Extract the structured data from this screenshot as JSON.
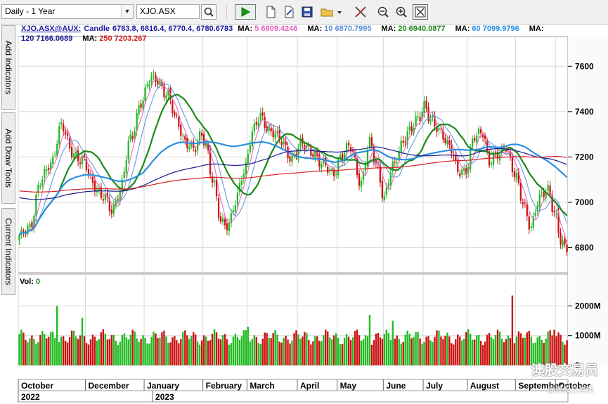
{
  "toolbar": {
    "period_value": "Daily - 1 Year",
    "symbol_value": "XJO.ASX"
  },
  "side_tabs": [
    "Add Indicators",
    "Add Draw Tools",
    "Current Indicators"
  ],
  "legend": {
    "symbol": "XJO.ASX@AUX:",
    "candle_label": "Candle",
    "ohlc": "6783.8, 6816.4, 6770.4, 6780.6783",
    "ma_prefix": "MA:",
    "ma": [
      {
        "period": "5",
        "value": "6809.4246",
        "color": "#e85ec0"
      },
      {
        "period": "10",
        "value": "6870.7995",
        "color": "#5b8fd6"
      },
      {
        "period": "20",
        "value": "6940.0877",
        "color": "#1a8a1a"
      },
      {
        "period": "60",
        "value": "7099.9796",
        "color": "#2a8fe0"
      },
      {
        "period": "120",
        "value": "7166.0689",
        "color": "#1a1a8a"
      },
      {
        "period": "250",
        "value": "7203.267",
        "color": "#d42020"
      }
    ]
  },
  "watermark": {
    "line1": "澳股交易员",
    "line2": "@澳股交易员"
  },
  "colors": {
    "up": "#22bb22",
    "down": "#cc1111",
    "grid": "#d8d8d8",
    "bg": "#ffffff"
  },
  "chart_data": {
    "type": "candlestick",
    "title": "XJO.ASX@AUX: Candle",
    "price_axis": {
      "ticks": [
        6800,
        7000,
        7200,
        7400,
        7600
      ],
      "labels": [
        "6800",
        "7000",
        "7200",
        "7400",
        "7600"
      ],
      "ylim": [
        6690,
        7700
      ]
    },
    "volume_axis": {
      "label": "Vol:",
      "value": "0",
      "ticks": [
        0,
        1000,
        2000
      ],
      "labels": [
        "0",
        "1000M",
        "2000M"
      ],
      "ylim": [
        0,
        2600
      ]
    },
    "x_months": [
      "October",
      "December",
      "January",
      "February",
      "March",
      "April",
      "May",
      "June",
      "July",
      "August",
      "September",
      "October"
    ],
    "x_years": [
      "2022",
      "2023"
    ],
    "price_anchors": [
      [
        0,
        6840
      ],
      [
        5,
        6900
      ],
      [
        10,
        7080
      ],
      [
        15,
        7180
      ],
      [
        20,
        7330
      ],
      [
        25,
        7230
      ],
      [
        30,
        7180
      ],
      [
        35,
        7090
      ],
      [
        40,
        7020
      ],
      [
        44,
        6960
      ],
      [
        48,
        7060
      ],
      [
        53,
        7270
      ],
      [
        58,
        7450
      ],
      [
        63,
        7540
      ],
      [
        66,
        7545
      ],
      [
        70,
        7480
      ],
      [
        75,
        7360
      ],
      [
        80,
        7260
      ],
      [
        83,
        7220
      ],
      [
        87,
        7310
      ],
      [
        89,
        7260
      ],
      [
        92,
        7090
      ],
      [
        96,
        6920
      ],
      [
        100,
        6910
      ],
      [
        103,
        6990
      ],
      [
        107,
        7140
      ],
      [
        111,
        7310
      ],
      [
        115,
        7370
      ],
      [
        120,
        7320
      ],
      [
        125,
        7260
      ],
      [
        130,
        7200
      ],
      [
        135,
        7250
      ],
      [
        140,
        7230
      ],
      [
        144,
        7160
      ],
      [
        150,
        7140
      ],
      [
        153,
        7190
      ],
      [
        158,
        7250
      ],
      [
        163,
        7080
      ],
      [
        167,
        7260
      ],
      [
        170,
        7190
      ],
      [
        174,
        7010
      ],
      [
        178,
        7160
      ],
      [
        182,
        7260
      ],
      [
        186,
        7300
      ],
      [
        190,
        7380
      ],
      [
        193,
        7430
      ],
      [
        196,
        7350
      ],
      [
        201,
        7320
      ],
      [
        205,
        7240
      ],
      [
        209,
        7140
      ],
      [
        213,
        7150
      ],
      [
        217,
        7280
      ],
      [
        221,
        7320
      ],
      [
        224,
        7180
      ],
      [
        228,
        7200
      ],
      [
        232,
        7260
      ],
      [
        236,
        7120
      ],
      [
        240,
        7000
      ],
      [
        244,
        6900
      ],
      [
        248,
        7010
      ],
      [
        252,
        7070
      ],
      [
        255,
        6960
      ],
      [
        258,
        6820
      ],
      [
        261,
        6781
      ]
    ],
    "ma_series": [
      {
        "name": "MA 5",
        "period": 5
      },
      {
        "name": "MA 10",
        "period": 10
      },
      {
        "name": "MA 20",
        "period": 20
      },
      {
        "name": "MA 60",
        "period": 60
      },
      {
        "name": "MA 120",
        "period": 120
      },
      {
        "name": "MA 250",
        "period": 250
      }
    ],
    "volume_typical_M": 950,
    "volume_spikes_M": [
      {
        "index": 18,
        "value": 2000
      },
      {
        "index": 30,
        "value": 1600
      },
      {
        "index": 109,
        "value": 1300
      },
      {
        "index": 167,
        "value": 1700
      },
      {
        "index": 178,
        "value": 1500
      },
      {
        "index": 235,
        "value": 2350
      },
      {
        "index": 255,
        "value": 1200
      }
    ],
    "last": {
      "open": 6783.8,
      "high": 6816.4,
      "low": 6770.4,
      "close": 6780.6783
    }
  }
}
